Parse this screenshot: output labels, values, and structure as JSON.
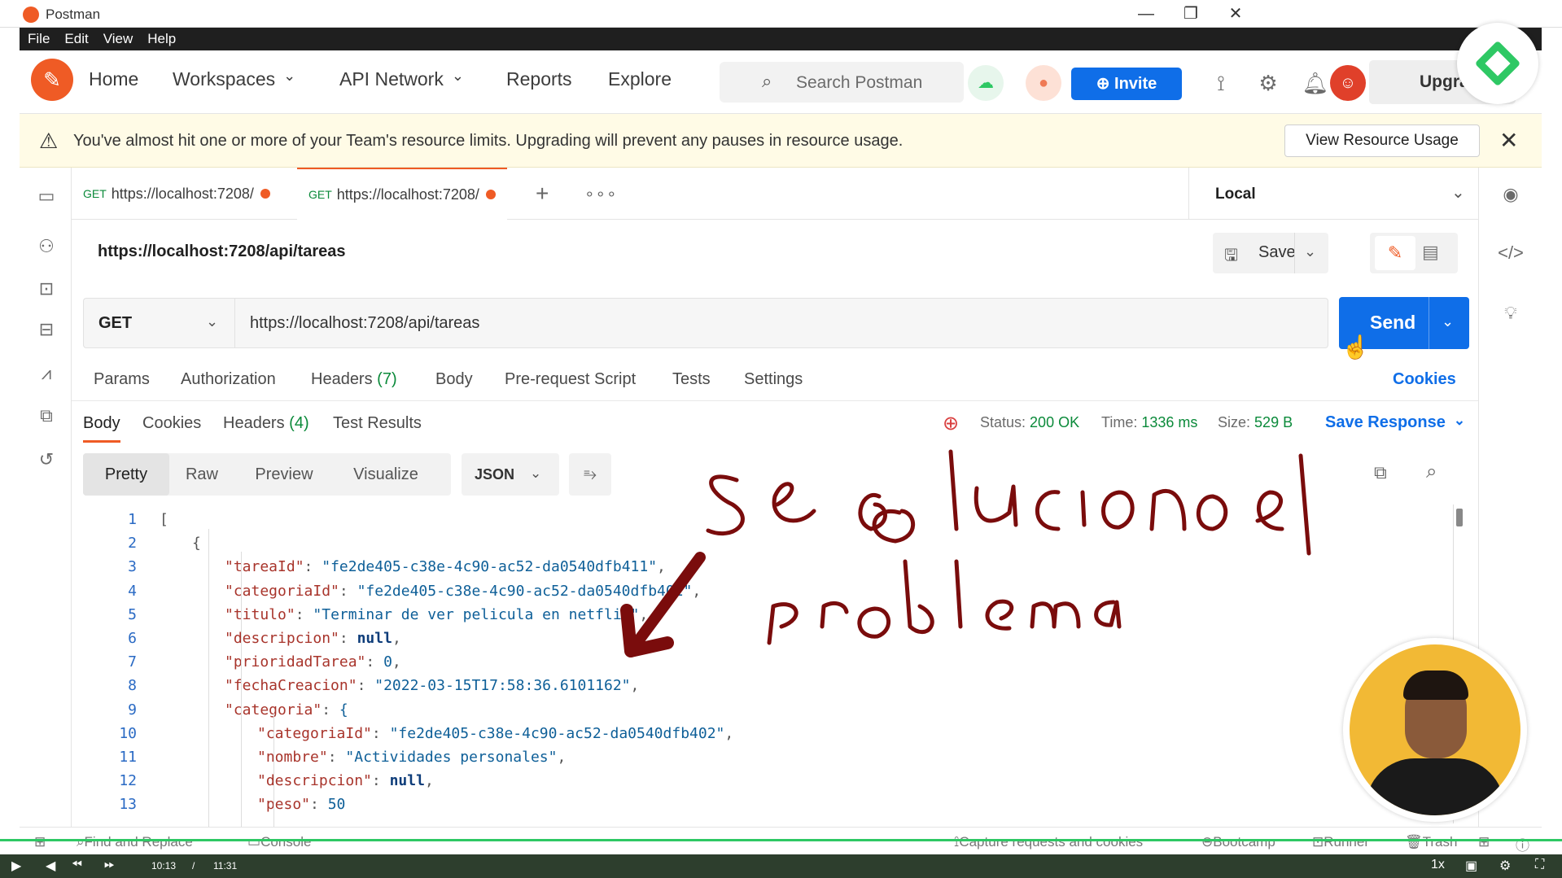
{
  "window": {
    "title": "Postman",
    "controls": [
      "—",
      "❐",
      "✕"
    ]
  },
  "menu": [
    "File",
    "Edit",
    "View",
    "Help"
  ],
  "header": {
    "nav": [
      {
        "label": "Home"
      },
      {
        "label": "Workspaces",
        "chevron": "⌄"
      },
      {
        "label": "API Network",
        "chevron": "⌄"
      },
      {
        "label": "Reports"
      },
      {
        "label": "Explore"
      }
    ],
    "search_placeholder": "Search Postman",
    "invite_label": "Invite",
    "upgrade_label": "Upgrade"
  },
  "banner": {
    "message": "You've almost hit one or more of your Team's resource limits. Upgrading will prevent any pauses in resource usage.",
    "button": "View Resource Usage"
  },
  "tabs": [
    {
      "method": "GET",
      "url": "https://localhost:7208/"
    },
    {
      "method": "GET",
      "url": "https://localhost:7208/"
    }
  ],
  "environment": "Local",
  "request": {
    "name": "https://localhost:7208/api/tareas",
    "method": "GET",
    "url": "https://localhost:7208/api/tareas",
    "save_label": "Save",
    "send_label": "Send"
  },
  "request_tabs": {
    "params": "Params",
    "authorization": "Authorization",
    "headers": "Headers",
    "headers_count": "(7)",
    "body": "Body",
    "prerequest": "Pre-request Script",
    "tests": "Tests",
    "settings": "Settings",
    "cookies": "Cookies"
  },
  "response_tabs": {
    "body": "Body",
    "cookies": "Cookies",
    "headers": "Headers",
    "headers_count": "(4)",
    "test_results": "Test Results"
  },
  "response_status": {
    "status_label": "Status:",
    "status_value": "200 OK",
    "time_label": "Time:",
    "time_value": "1336 ms",
    "size_label": "Size:",
    "size_value": "529 B",
    "save_response": "Save Response"
  },
  "response_views": {
    "pretty": "Pretty",
    "raw": "Raw",
    "preview": "Preview",
    "visualize": "Visualize",
    "format": "JSON"
  },
  "code_lines": [
    {
      "n": "1",
      "text": "["
    },
    {
      "n": "2",
      "text": "{"
    },
    {
      "n": "3",
      "key": "\"tareaId\"",
      "val": "\"fe2de405-c38e-4c90-ac52-da0540dfb411\"",
      "end": ","
    },
    {
      "n": "4",
      "key": "\"categoriaId\"",
      "val": "\"fe2de405-c38e-4c90-ac52-da0540dfb402\"",
      "end": ","
    },
    {
      "n": "5",
      "key": "\"titulo\"",
      "val": "\"Terminar de ver pelicula en netflix\"",
      "end": ","
    },
    {
      "n": "6",
      "key": "\"descripcion\"",
      "kw": "null",
      "end": ","
    },
    {
      "n": "7",
      "key": "\"prioridadTarea\"",
      "val": "0",
      "end": ","
    },
    {
      "n": "8",
      "key": "\"fechaCreacion\"",
      "val": "\"2022-03-15T17:58:36.6101162\"",
      "end": ","
    },
    {
      "n": "9",
      "key": "\"categoria\"",
      "val": "{",
      "end": ""
    },
    {
      "n": "10",
      "key": "\"categoriaId\"",
      "val": "\"fe2de405-c38e-4c90-ac52-da0540dfb402\"",
      "end": ","
    },
    {
      "n": "11",
      "key": "\"nombre\"",
      "val": "\"Actividades personales\"",
      "end": ","
    },
    {
      "n": "12",
      "key": "\"descripcion\"",
      "kw": "null",
      "end": ","
    },
    {
      "n": "13",
      "key": "\"peso\"",
      "val": "50",
      "end": ""
    }
  ],
  "statusbar": {
    "find_replace": "Find and Replace",
    "console": "Console",
    "capture": "Capture requests and cookies",
    "bootcamp": "Bootcamp",
    "runner": "Runner",
    "trash": "Trash"
  },
  "player": {
    "current": "10:13",
    "separator": "/",
    "total": "11:31",
    "speed": "1x"
  },
  "colors": {
    "accent": "#ef5b25",
    "primary": "#0f6ee8",
    "success": "#0b8a3a",
    "annotation": "#7a0c0c"
  }
}
